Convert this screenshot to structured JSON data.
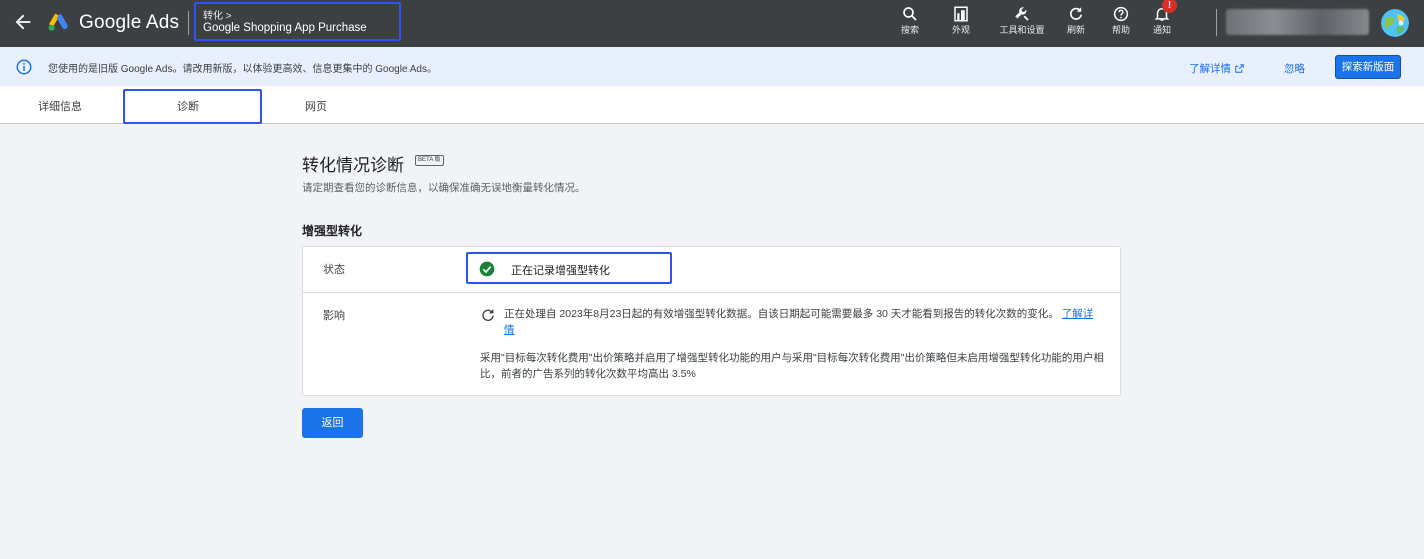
{
  "topbar": {
    "brand": "Google Ads",
    "breadcrumb_parent": "转化 >",
    "breadcrumb_title": "Google Shopping App Purchase",
    "tools": [
      {
        "label": "搜索",
        "icon": "search-icon"
      },
      {
        "label": "外观",
        "icon": "appearance-icon"
      },
      {
        "label": "工具和设置",
        "icon": "wrench-icon"
      },
      {
        "label": "刷新",
        "icon": "refresh-icon"
      },
      {
        "label": "帮助",
        "icon": "help-icon"
      },
      {
        "label": "通知",
        "icon": "bell-icon"
      }
    ],
    "notification_badge": "!"
  },
  "notice": {
    "text": "您使用的是旧版 Google Ads。请改用新版，以体验更高效、信息更集中的 Google Ads。",
    "learn_more": "了解详情",
    "dismiss": "忽略",
    "explore": "探索新版面"
  },
  "tabs": [
    {
      "label": "详细信息"
    },
    {
      "label": "诊断",
      "active": true
    },
    {
      "label": "网页"
    }
  ],
  "main": {
    "title": "转化情况诊断",
    "beta": "BETA 版",
    "subtitle": "请定期查看您的诊断信息，以确保准确无误地衡量转化情况。",
    "section_title": "增强型转化",
    "status_label": "状态",
    "status_value": "正在记录增强型转化",
    "impact_label": "影响",
    "impact_text": "正在处理自 2023年8月23日起的有效增强型转化数据。自该日期起可能需要最多 30 天才能看到报告的转化次数的变化。",
    "impact_link": "了解详情",
    "impact_note": "采用\"目标每次转化费用\"出价策略并启用了增强型转化功能的用户与采用\"目标每次转化费用\"出价策略但未启用增强型转化功能的用户相比，前者的广告系列的转化次数平均高出 3.5%",
    "back_button": "返回"
  },
  "colors": {
    "topbar": "#3c4043",
    "accent": "#1a73e8",
    "highlight_box": "#2f54eb",
    "success": "#188038",
    "notice_bg": "#e8f0fe"
  }
}
